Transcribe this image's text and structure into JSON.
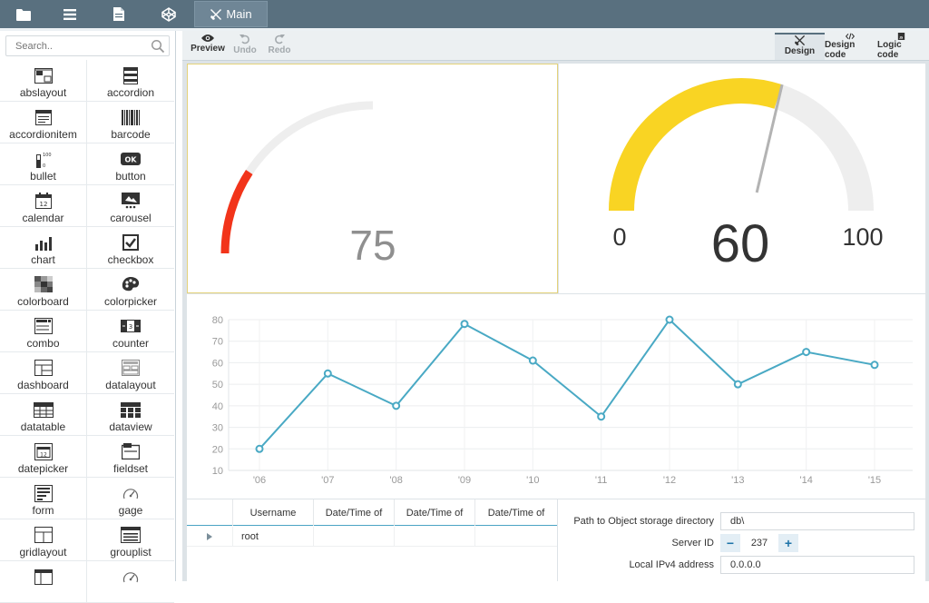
{
  "topbar": {
    "buttons": [
      {
        "icon": "folder-icon"
      },
      {
        "icon": "menu-icon"
      },
      {
        "icon": "file-icon"
      },
      {
        "icon": "codepen-icon"
      }
    ],
    "tab_label": "Main",
    "tab_icon": "tools-icon"
  },
  "sidebar": {
    "search_placeholder": "Search..",
    "items": [
      {
        "label": "abslayout",
        "icon": "abslayout-icon"
      },
      {
        "label": "accordion",
        "icon": "accordion-icon"
      },
      {
        "label": "accordionitem",
        "icon": "accordionitem-icon"
      },
      {
        "label": "barcode",
        "icon": "barcode-icon"
      },
      {
        "label": "bullet",
        "icon": "bullet-icon"
      },
      {
        "label": "button",
        "icon": "button-icon"
      },
      {
        "label": "calendar",
        "icon": "calendar-icon"
      },
      {
        "label": "carousel",
        "icon": "carousel-icon"
      },
      {
        "label": "chart",
        "icon": "chart-icon"
      },
      {
        "label": "checkbox",
        "icon": "checkbox-icon"
      },
      {
        "label": "colorboard",
        "icon": "colorboard-icon"
      },
      {
        "label": "colorpicker",
        "icon": "colorpicker-icon"
      },
      {
        "label": "combo",
        "icon": "combo-icon"
      },
      {
        "label": "counter",
        "icon": "counter-icon"
      },
      {
        "label": "dashboard",
        "icon": "dashboard-icon"
      },
      {
        "label": "datalayout",
        "icon": "datalayout-icon"
      },
      {
        "label": "datatable",
        "icon": "datatable-icon"
      },
      {
        "label": "dataview",
        "icon": "dataview-icon"
      },
      {
        "label": "datepicker",
        "icon": "datepicker-icon"
      },
      {
        "label": "fieldset",
        "icon": "fieldset-icon"
      },
      {
        "label": "form",
        "icon": "form-icon"
      },
      {
        "label": "gage",
        "icon": "gage-icon"
      },
      {
        "label": "gridlayout",
        "icon": "gridlayout-icon"
      },
      {
        "label": "grouplist",
        "icon": "grouplist-icon"
      },
      {
        "label": "",
        "icon": "table-icon"
      },
      {
        "label": "",
        "icon": "gage-icon"
      }
    ]
  },
  "toolbar": {
    "preview": "Preview",
    "undo": "Undo",
    "redo": "Redo",
    "design": "Design",
    "design_code": "Design code",
    "logic_code": "Logic code"
  },
  "gauge1": {
    "value": "75",
    "fraction": 0.75,
    "color": "#f2341a",
    "track": "#eeeeee"
  },
  "gauge2": {
    "min": "0",
    "max": "100",
    "value": "60",
    "fraction": 0.6,
    "color": "#f9d423",
    "track": "#eeeeee",
    "needle": "#b3b3b3"
  },
  "chart_data": {
    "type": "line",
    "categories": [
      "'06",
      "'07",
      "'08",
      "'09",
      "'10",
      "'11",
      "'12",
      "'13",
      "'14",
      "'15"
    ],
    "values": [
      20,
      55,
      40,
      78,
      61,
      35,
      80,
      50,
      65,
      59
    ],
    "ylim": [
      10,
      80
    ],
    "yticks": [
      10,
      20,
      30,
      40,
      50,
      60,
      70,
      80
    ],
    "grid": true,
    "color": "#49a9c4"
  },
  "grid": {
    "columns": [
      "",
      "Username",
      "Date/Time of",
      "Date/Time of",
      "Date/Time of"
    ],
    "rows": [
      [
        "",
        "root",
        "",
        "",
        ""
      ]
    ]
  },
  "form": {
    "path_label": "Path to Object storage directory",
    "path_value": "db\\",
    "server_label": "Server ID",
    "server_value": "237",
    "minus": "−",
    "plus": "+",
    "ip_label": "Local IPv4 address",
    "ip_value": "0.0.0.0"
  }
}
